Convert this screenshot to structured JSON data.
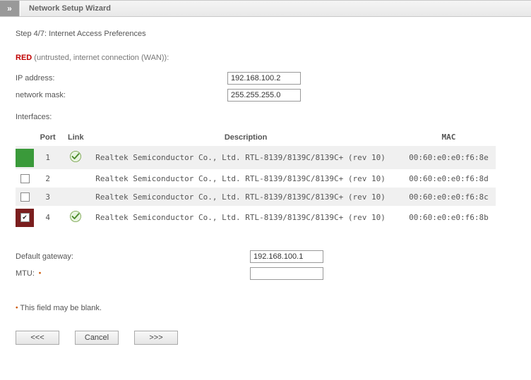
{
  "header": {
    "expand_glyph": "»",
    "title": "Network Setup Wizard"
  },
  "step_label": "Step 4/7: Internet Access Preferences",
  "red": {
    "label": "RED",
    "desc": "(untrusted, internet connection (WAN)):"
  },
  "fields": {
    "ip_label": "IP address:",
    "ip_value": "192.168.100.2",
    "mask_label": "network mask:",
    "mask_value": "255.255.255.0",
    "interfaces_label": "Interfaces:",
    "gateway_label": "Default gateway:",
    "gateway_value": "192.168.100.1",
    "mtu_label": "MTU:",
    "mtu_value": ""
  },
  "table": {
    "headers": {
      "port": "Port",
      "link": "Link",
      "description": "Description",
      "mac": "MAC"
    },
    "rows": [
      {
        "sel_color": "green",
        "checked": false,
        "show_check": false,
        "port": "1",
        "link": true,
        "desc": "Realtek Semiconductor Co., Ltd. RTL-8139/8139C/8139C+ (rev 10)",
        "mac": "00:60:e0:e0:f6:8e"
      },
      {
        "sel_color": "gray",
        "checked": false,
        "show_check": true,
        "port": "2",
        "link": false,
        "desc": "Realtek Semiconductor Co., Ltd. RTL-8139/8139C/8139C+ (rev 10)",
        "mac": "00:60:e0:e0:f6:8d"
      },
      {
        "sel_color": "gray",
        "checked": false,
        "show_check": true,
        "port": "3",
        "link": false,
        "desc": "Realtek Semiconductor Co., Ltd. RTL-8139/8139C/8139C+ (rev 10)",
        "mac": "00:60:e0:e0:f6:8c"
      },
      {
        "sel_color": "darkred",
        "checked": true,
        "show_check": true,
        "port": "4",
        "link": true,
        "desc": "Realtek Semiconductor Co., Ltd. RTL-8139/8139C/8139C+ (rev 10)",
        "mac": "00:60:e0:e0:f6:8b"
      }
    ]
  },
  "note": {
    "text": "This field may be blank."
  },
  "buttons": {
    "back": "<<<",
    "cancel": "Cancel",
    "next": ">>>"
  }
}
